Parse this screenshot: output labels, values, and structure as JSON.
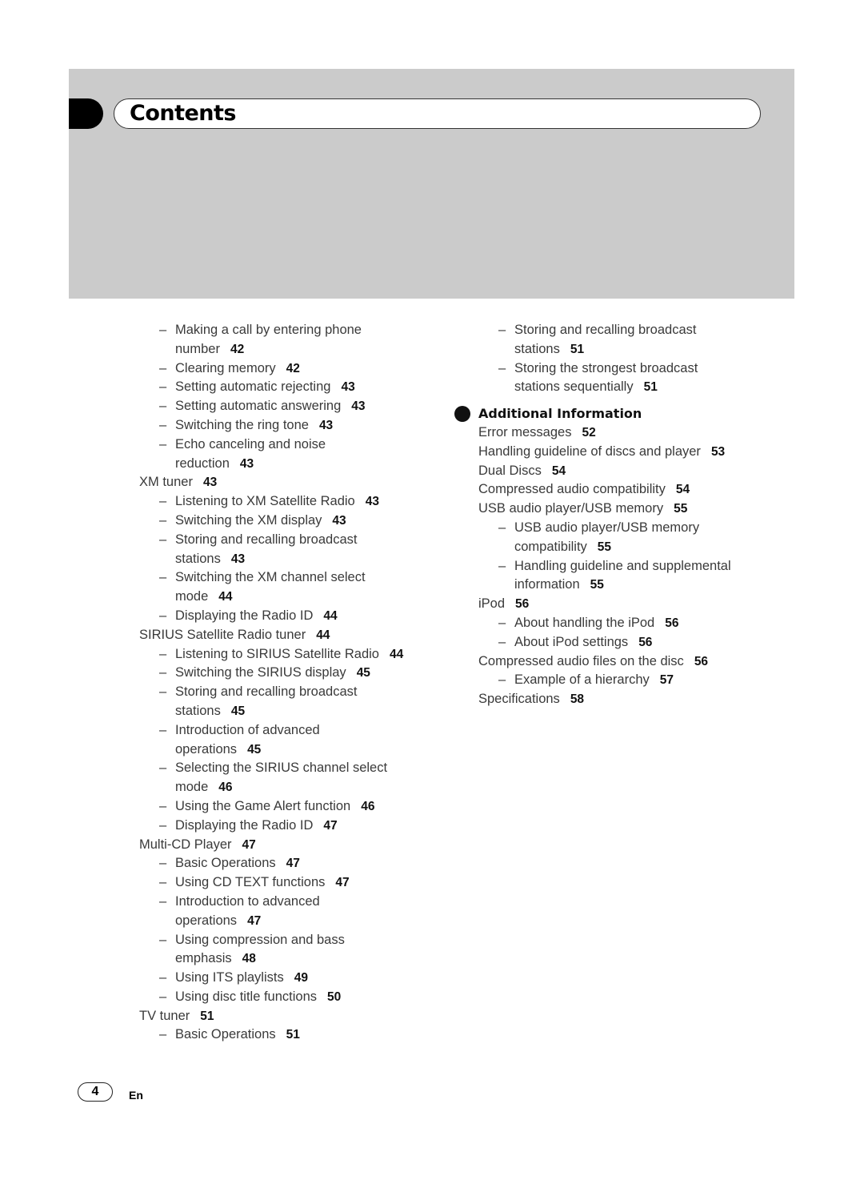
{
  "header": {
    "title": "Contents"
  },
  "left_column": [
    {
      "level": 2,
      "text": "Making a call by entering phone",
      "cont": "number",
      "page": "42"
    },
    {
      "level": 2,
      "text": "Clearing memory",
      "page": "42"
    },
    {
      "level": 2,
      "text": "Setting automatic rejecting",
      "page": "43"
    },
    {
      "level": 2,
      "text": "Setting automatic answering",
      "page": "43"
    },
    {
      "level": 2,
      "text": "Switching the ring tone",
      "page": "43"
    },
    {
      "level": 2,
      "text": "Echo canceling and noise",
      "cont": "reduction",
      "page": "43"
    },
    {
      "level": 1,
      "text": "XM tuner",
      "page": "43"
    },
    {
      "level": 2,
      "text": "Listening to XM Satellite Radio",
      "page": "43"
    },
    {
      "level": 2,
      "text": "Switching the XM display",
      "page": "43"
    },
    {
      "level": 2,
      "text": "Storing and recalling broadcast",
      "cont": "stations",
      "page": "43"
    },
    {
      "level": 2,
      "text": "Switching the XM channel select",
      "cont": "mode",
      "page": "44"
    },
    {
      "level": 2,
      "text": "Displaying the Radio ID",
      "page": "44"
    },
    {
      "level": 1,
      "text": "SIRIUS Satellite Radio tuner",
      "page": "44"
    },
    {
      "level": 2,
      "text": "Listening to SIRIUS Satellite Radio",
      "page": "44"
    },
    {
      "level": 2,
      "text": "Switching the SIRIUS display",
      "page": "45"
    },
    {
      "level": 2,
      "text": "Storing and recalling broadcast",
      "cont": "stations",
      "page": "45"
    },
    {
      "level": 2,
      "text": "Introduction of advanced",
      "cont": "operations",
      "page": "45"
    },
    {
      "level": 2,
      "text": "Selecting the SIRIUS channel select",
      "cont": "mode",
      "page": "46"
    },
    {
      "level": 2,
      "text": "Using the Game Alert function",
      "page": "46"
    },
    {
      "level": 2,
      "text": "Displaying the Radio ID",
      "page": "47"
    },
    {
      "level": 1,
      "text": "Multi-CD Player",
      "page": "47"
    },
    {
      "level": 2,
      "text": "Basic Operations",
      "page": "47"
    },
    {
      "level": 2,
      "text": "Using CD TEXT functions",
      "page": "47"
    },
    {
      "level": 2,
      "text": "Introduction to advanced",
      "cont": "operations",
      "page": "47"
    },
    {
      "level": 2,
      "text": "Using compression and bass",
      "cont": "emphasis",
      "page": "48"
    },
    {
      "level": 2,
      "text": "Using ITS playlists",
      "page": "49"
    },
    {
      "level": 2,
      "text": "Using disc title functions",
      "page": "50"
    },
    {
      "level": 1,
      "text": "TV tuner",
      "page": "51"
    },
    {
      "level": 2,
      "text": "Basic Operations",
      "page": "51"
    }
  ],
  "right_column": {
    "before": [
      {
        "level": 2,
        "text": "Storing and recalling broadcast",
        "cont": "stations",
        "page": "51"
      },
      {
        "level": 2,
        "text": "Storing the strongest broadcast",
        "cont": "stations sequentially",
        "page": "51"
      }
    ],
    "section_title": "Additional Information",
    "after": [
      {
        "level": 1,
        "text": "Error messages",
        "page": "52"
      },
      {
        "level": 1,
        "text": "Handling guideline of discs and player",
        "page": "53"
      },
      {
        "level": 1,
        "text": "Dual Discs",
        "page": "54"
      },
      {
        "level": 1,
        "text": "Compressed audio compatibility",
        "page": "54"
      },
      {
        "level": 1,
        "text": "USB audio player/USB memory",
        "page": "55"
      },
      {
        "level": 2,
        "text": "USB audio player/USB memory",
        "cont": "compatibility",
        "page": "55"
      },
      {
        "level": 2,
        "text": "Handling guideline and supplemental",
        "cont": "information",
        "page": "55"
      },
      {
        "level": 1,
        "text": "iPod",
        "page": "56"
      },
      {
        "level": 2,
        "text": "About handling the iPod",
        "page": "56"
      },
      {
        "level": 2,
        "text": "About iPod settings",
        "page": "56"
      },
      {
        "level": 1,
        "text": "Compressed audio files on the disc",
        "page": "56"
      },
      {
        "level": 2,
        "text": "Example of a hierarchy",
        "page": "57"
      },
      {
        "level": 1,
        "text": "Specifications",
        "page": "58"
      }
    ]
  },
  "footer": {
    "page_number": "4",
    "language": "En"
  },
  "dash": "–"
}
